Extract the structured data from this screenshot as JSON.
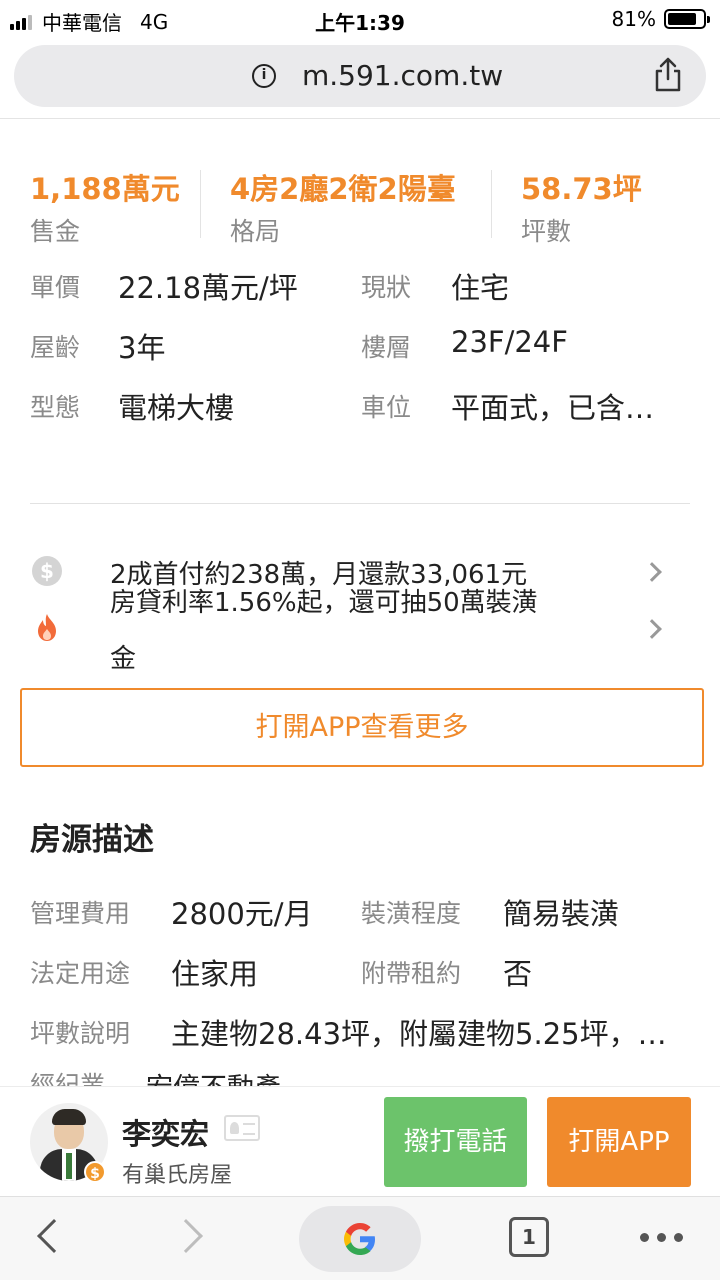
{
  "status_bar": {
    "carrier": "中華電信",
    "network": "4G",
    "time": "上午1:39",
    "battery": "81%",
    "battery_level": 0.81
  },
  "browser": {
    "url": "m.591.com.tw",
    "info_icon": "info-icon",
    "share_icon": "share-icon",
    "tab_count": "1"
  },
  "key_stats": [
    {
      "value": "1,188萬元",
      "label": "售金"
    },
    {
      "value": "4房2廳2衛2陽臺",
      "label": "格局"
    },
    {
      "value": "58.73坪",
      "label": "坪數"
    }
  ],
  "details": {
    "unit_price_label": "單價",
    "unit_price": "22.18萬元/坪",
    "status_label": "現狀",
    "status": "住宅",
    "age_label": "屋齡",
    "age": "3年",
    "floor_label": "樓層",
    "floor": "23F/24F",
    "type_label": "型態",
    "type": "電梯大樓",
    "parking_label": "車位",
    "parking": "平面式，已含…"
  },
  "promo": {
    "line1": "2成首付約238萬，月還款33,061元",
    "line2": "房貸利率1.56%起，還可抽50萬裝潢",
    "line3": "金",
    "icons": [
      "dollar-coin-icon",
      "flame-icon"
    ]
  },
  "open_app_more": "打開APP查看更多",
  "description": {
    "title": "房源描述",
    "mgmt_fee_label": "管理費用",
    "mgmt_fee": "2800元/月",
    "decoration_label": "裝潢程度",
    "decoration": "簡易裝潢",
    "usage_label": "法定用途",
    "usage": "住家用",
    "lease_label": "附帶租約",
    "lease": "否",
    "area_note_label": "坪數說明",
    "area_note": "主建物28.43坪，附屬建物5.25坪，…",
    "cut_label": "經紀業",
    "cut_value": "宏億不動產"
  },
  "agent": {
    "name": "李奕宏",
    "company": "有巢氏房屋",
    "call_button": "撥打電話",
    "app_button": "打開APP"
  },
  "colors": {
    "accent": "#f08a2c",
    "call_green": "#6cc36b",
    "label_gray": "#8a8a8a"
  }
}
